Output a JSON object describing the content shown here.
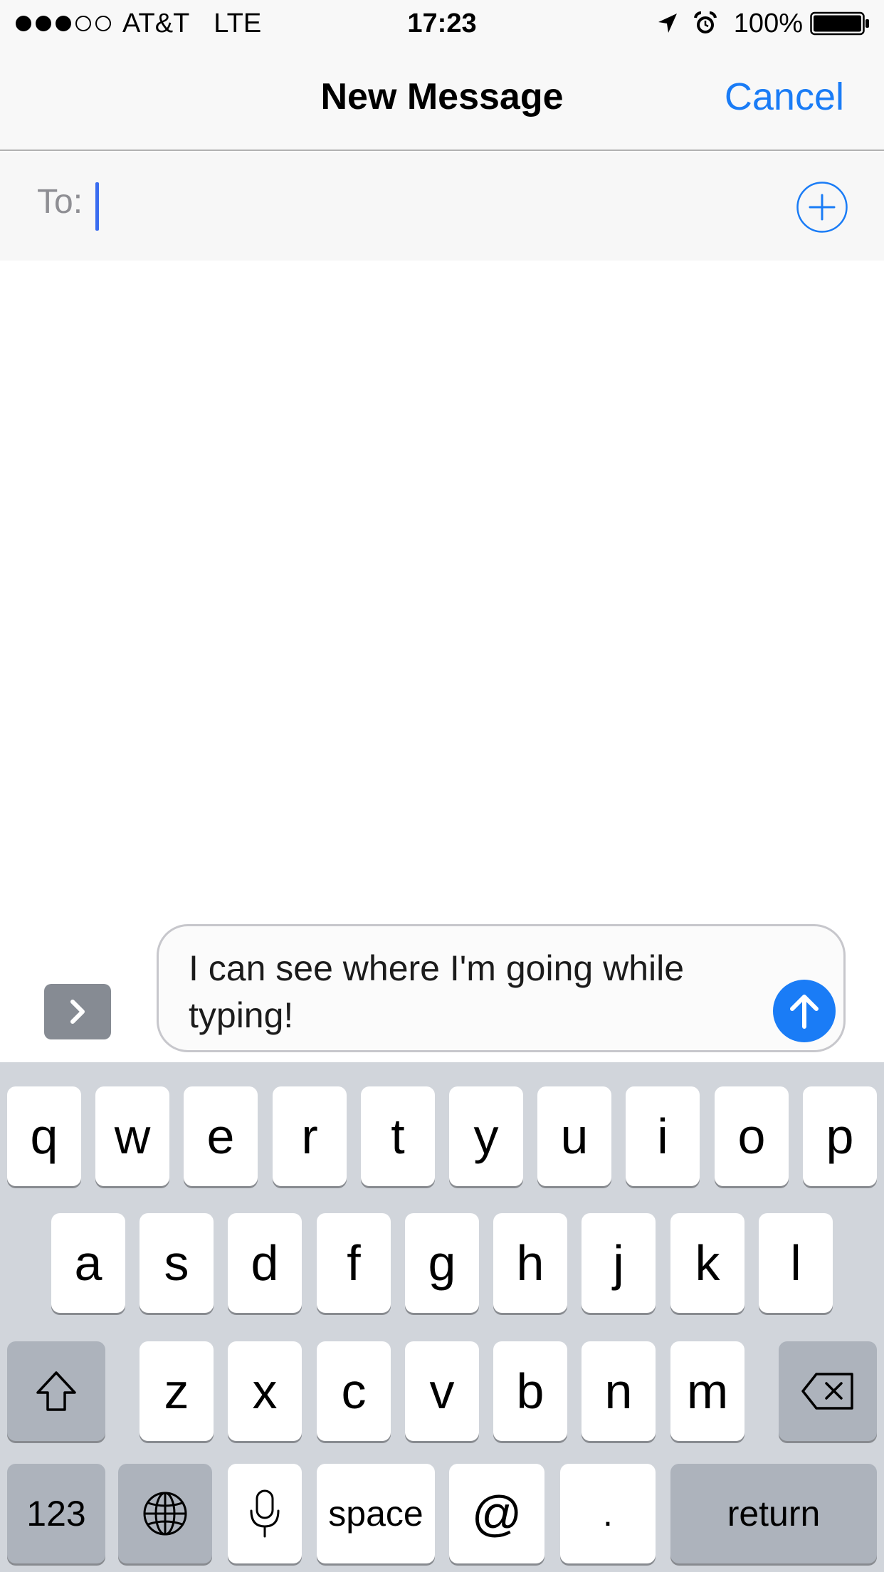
{
  "status_bar": {
    "carrier": "AT&T",
    "network": "LTE",
    "time": "17:23",
    "battery": "100%",
    "signal_bars_filled": 3,
    "signal_bars_total": 5,
    "icons": [
      "location-arrow-icon",
      "alarm-clock-icon",
      "battery-icon"
    ]
  },
  "nav": {
    "title": "New Message",
    "cancel_label": "Cancel"
  },
  "to_field": {
    "label": "To:",
    "value": "",
    "add_icon": "plus-circle-icon"
  },
  "compose": {
    "text": "I can see where I'm going while typing!",
    "apps_icon": "chevron-right-icon",
    "send_icon": "arrow-up-icon"
  },
  "keyboard": {
    "row1": [
      "q",
      "w",
      "e",
      "r",
      "t",
      "y",
      "u",
      "i",
      "o",
      "p"
    ],
    "row2": [
      "a",
      "s",
      "d",
      "f",
      "g",
      "h",
      "j",
      "k",
      "l"
    ],
    "row3": [
      "z",
      "x",
      "c",
      "v",
      "b",
      "n",
      "m"
    ],
    "numbers_label": "123",
    "space_label": "space",
    "at_label": "@",
    "period_label": ".",
    "return_label": "return",
    "shift_icon": "shift-arrow-icon",
    "delete_icon": "backspace-icon",
    "globe_icon": "globe-icon",
    "mic_icon": "microphone-icon"
  },
  "colors": {
    "accent": "#1a7cf6",
    "keyboard_bg": "#d1d5db",
    "dark_key": "#adb3bc"
  }
}
